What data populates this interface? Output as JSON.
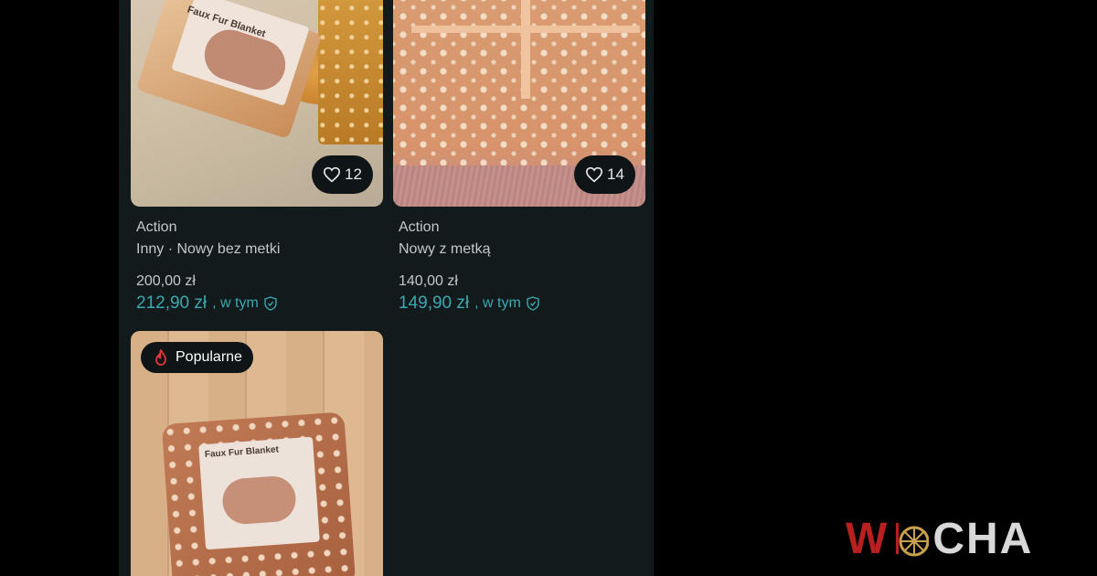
{
  "listings": [
    {
      "brand": "Action",
      "status": "Inny · Nowy bez metki",
      "price": "200,00 zł",
      "total_price": "212,90 zł",
      "fee_note": ", w tym",
      "likes": "12",
      "image_text": "Faux Fur Blanket"
    },
    {
      "brand": "Action",
      "status": "Nowy z metką",
      "price": "140,00 zł",
      "total_price": "149,90 zł",
      "fee_note": ", w tym",
      "likes": "14"
    },
    {
      "badge": "Popularne",
      "image_text": "Faux Fur Blanket"
    }
  ],
  "watermark": {
    "first_letter": "W",
    "rest": "CHA"
  },
  "colors": {
    "background": "#000000",
    "panel": "#121a1c",
    "accent_price": "#3aa9b0",
    "badge_flame": "#e5373a",
    "logo_red": "#b8201f"
  },
  "icons": [
    "heart-icon",
    "shield-check-icon",
    "flame-icon",
    "wheel-icon"
  ]
}
